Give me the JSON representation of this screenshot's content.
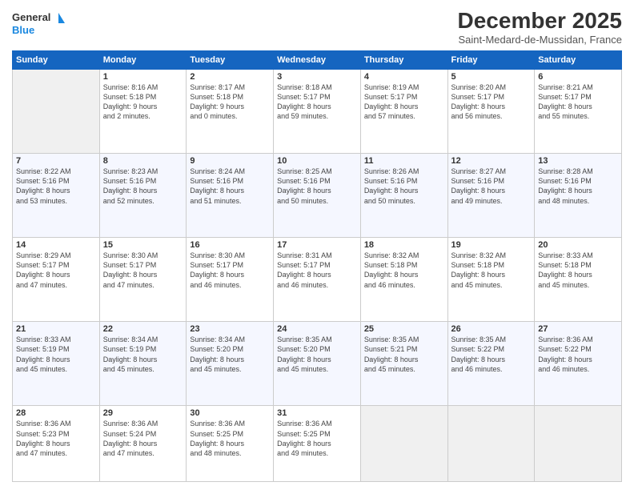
{
  "header": {
    "logo_line1": "General",
    "logo_line2": "Blue",
    "month": "December 2025",
    "location": "Saint-Medard-de-Mussidan, France"
  },
  "days": [
    "Sunday",
    "Monday",
    "Tuesday",
    "Wednesday",
    "Thursday",
    "Friday",
    "Saturday"
  ],
  "weeks": [
    [
      {
        "day": "",
        "content": ""
      },
      {
        "day": "1",
        "content": "Sunrise: 8:16 AM\nSunset: 5:18 PM\nDaylight: 9 hours\nand 2 minutes."
      },
      {
        "day": "2",
        "content": "Sunrise: 8:17 AM\nSunset: 5:18 PM\nDaylight: 9 hours\nand 0 minutes."
      },
      {
        "day": "3",
        "content": "Sunrise: 8:18 AM\nSunset: 5:17 PM\nDaylight: 8 hours\nand 59 minutes."
      },
      {
        "day": "4",
        "content": "Sunrise: 8:19 AM\nSunset: 5:17 PM\nDaylight: 8 hours\nand 57 minutes."
      },
      {
        "day": "5",
        "content": "Sunrise: 8:20 AM\nSunset: 5:17 PM\nDaylight: 8 hours\nand 56 minutes."
      },
      {
        "day": "6",
        "content": "Sunrise: 8:21 AM\nSunset: 5:17 PM\nDaylight: 8 hours\nand 55 minutes."
      }
    ],
    [
      {
        "day": "7",
        "content": "Sunrise: 8:22 AM\nSunset: 5:16 PM\nDaylight: 8 hours\nand 53 minutes."
      },
      {
        "day": "8",
        "content": "Sunrise: 8:23 AM\nSunset: 5:16 PM\nDaylight: 8 hours\nand 52 minutes."
      },
      {
        "day": "9",
        "content": "Sunrise: 8:24 AM\nSunset: 5:16 PM\nDaylight: 8 hours\nand 51 minutes."
      },
      {
        "day": "10",
        "content": "Sunrise: 8:25 AM\nSunset: 5:16 PM\nDaylight: 8 hours\nand 50 minutes."
      },
      {
        "day": "11",
        "content": "Sunrise: 8:26 AM\nSunset: 5:16 PM\nDaylight: 8 hours\nand 50 minutes."
      },
      {
        "day": "12",
        "content": "Sunrise: 8:27 AM\nSunset: 5:16 PM\nDaylight: 8 hours\nand 49 minutes."
      },
      {
        "day": "13",
        "content": "Sunrise: 8:28 AM\nSunset: 5:16 PM\nDaylight: 8 hours\nand 48 minutes."
      }
    ],
    [
      {
        "day": "14",
        "content": "Sunrise: 8:29 AM\nSunset: 5:17 PM\nDaylight: 8 hours\nand 47 minutes."
      },
      {
        "day": "15",
        "content": "Sunrise: 8:30 AM\nSunset: 5:17 PM\nDaylight: 8 hours\nand 47 minutes."
      },
      {
        "day": "16",
        "content": "Sunrise: 8:30 AM\nSunset: 5:17 PM\nDaylight: 8 hours\nand 46 minutes."
      },
      {
        "day": "17",
        "content": "Sunrise: 8:31 AM\nSunset: 5:17 PM\nDaylight: 8 hours\nand 46 minutes."
      },
      {
        "day": "18",
        "content": "Sunrise: 8:32 AM\nSunset: 5:18 PM\nDaylight: 8 hours\nand 46 minutes."
      },
      {
        "day": "19",
        "content": "Sunrise: 8:32 AM\nSunset: 5:18 PM\nDaylight: 8 hours\nand 45 minutes."
      },
      {
        "day": "20",
        "content": "Sunrise: 8:33 AM\nSunset: 5:18 PM\nDaylight: 8 hours\nand 45 minutes."
      }
    ],
    [
      {
        "day": "21",
        "content": "Sunrise: 8:33 AM\nSunset: 5:19 PM\nDaylight: 8 hours\nand 45 minutes."
      },
      {
        "day": "22",
        "content": "Sunrise: 8:34 AM\nSunset: 5:19 PM\nDaylight: 8 hours\nand 45 minutes."
      },
      {
        "day": "23",
        "content": "Sunrise: 8:34 AM\nSunset: 5:20 PM\nDaylight: 8 hours\nand 45 minutes."
      },
      {
        "day": "24",
        "content": "Sunrise: 8:35 AM\nSunset: 5:20 PM\nDaylight: 8 hours\nand 45 minutes."
      },
      {
        "day": "25",
        "content": "Sunrise: 8:35 AM\nSunset: 5:21 PM\nDaylight: 8 hours\nand 45 minutes."
      },
      {
        "day": "26",
        "content": "Sunrise: 8:35 AM\nSunset: 5:22 PM\nDaylight: 8 hours\nand 46 minutes."
      },
      {
        "day": "27",
        "content": "Sunrise: 8:36 AM\nSunset: 5:22 PM\nDaylight: 8 hours\nand 46 minutes."
      }
    ],
    [
      {
        "day": "28",
        "content": "Sunrise: 8:36 AM\nSunset: 5:23 PM\nDaylight: 8 hours\nand 47 minutes."
      },
      {
        "day": "29",
        "content": "Sunrise: 8:36 AM\nSunset: 5:24 PM\nDaylight: 8 hours\nand 47 minutes."
      },
      {
        "day": "30",
        "content": "Sunrise: 8:36 AM\nSunset: 5:25 PM\nDaylight: 8 hours\nand 48 minutes."
      },
      {
        "day": "31",
        "content": "Sunrise: 8:36 AM\nSunset: 5:25 PM\nDaylight: 8 hours\nand 49 minutes."
      },
      {
        "day": "",
        "content": ""
      },
      {
        "day": "",
        "content": ""
      },
      {
        "day": "",
        "content": ""
      }
    ]
  ]
}
